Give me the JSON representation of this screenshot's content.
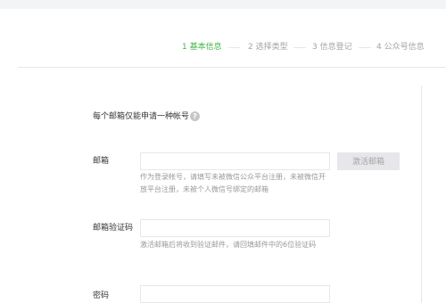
{
  "steps": [
    {
      "label": "1 基本信息",
      "active": true
    },
    {
      "label": "2 选择类型",
      "active": false
    },
    {
      "label": "3 信息登记",
      "active": false
    },
    {
      "label": "4 公众号信息",
      "active": false
    }
  ],
  "colors": {
    "active": "#44b549",
    "inactive": "#a4a4a4",
    "border": "#e4e8eb"
  },
  "form": {
    "tip": "每个邮箱仅能申请一种帐号",
    "tip_icon": "question-circle-icon",
    "email": {
      "label": "邮箱",
      "value": "",
      "placeholder": "",
      "hint": "作为登录帐号，请填写未被微信公众平台注册，未被微信开放平台注册，未被个人微信号绑定的邮箱",
      "activate_button": "激活邮箱"
    },
    "code": {
      "label": "邮箱验证码",
      "value": "",
      "placeholder": "",
      "hint": "激活邮箱后将收到验证邮件，请回填邮件中的6位验证码"
    },
    "password": {
      "label": "密码",
      "value": "",
      "placeholder": ""
    }
  }
}
